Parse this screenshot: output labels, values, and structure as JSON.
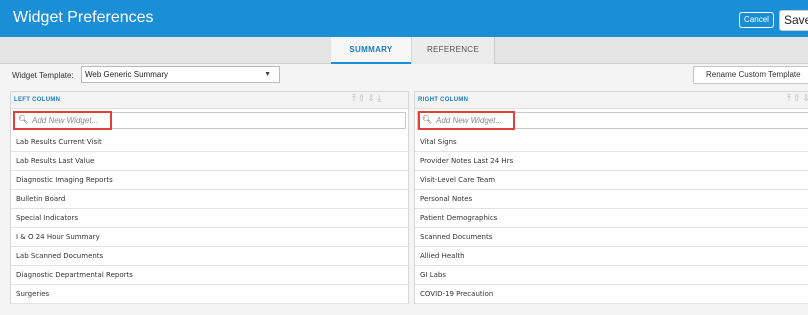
{
  "window": {
    "title": "Widget Preferences"
  },
  "header": {
    "cancel_label": "Cancel",
    "save_label": "Save"
  },
  "tabs": [
    {
      "label": "SUMMARY"
    },
    {
      "label": "REFERENCE"
    }
  ],
  "template": {
    "label": "Widget Template:",
    "selected": "Web Generic Summary",
    "rename_label": "Rename Custom Template"
  },
  "left_column": {
    "header": "LEFT COLUMN",
    "search_placeholder": "Add New Widget...",
    "items": [
      "Lab Results Current Visit",
      "Lab Results Last Value",
      "Diagnostic Imaging Reports",
      "Bulletin Board",
      "Special Indicators",
      "I & O 24 Hour Summary",
      "Lab Scanned Documents",
      "Diagnostic Departmental Reports",
      "Surgeries"
    ]
  },
  "right_column": {
    "header": "RIGHT COLUMN",
    "search_placeholder": "Add New Widget...",
    "items": [
      "Vital Signs",
      "Provider Notes Last 24 Hrs",
      "Visit-Level Care Team",
      "Personal Notes",
      "Patient Demographics",
      "Scanned Documents",
      "Allied Health",
      "GI Labs",
      "COVID-19 Precaution"
    ]
  },
  "colors": {
    "brand": "#1b8fd6",
    "highlight": "#e0403a"
  }
}
